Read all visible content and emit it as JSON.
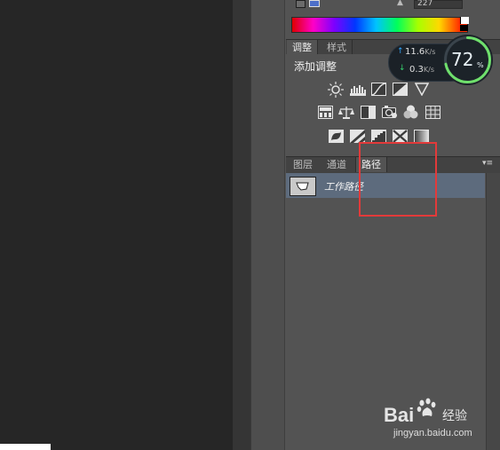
{
  "color_panel": {
    "value": "227",
    "colors": {
      "swatch": "#4d6fc9"
    }
  },
  "adjustments_panel": {
    "tabs": [
      "调整",
      "样式"
    ],
    "title": "添加调整",
    "row1": [
      "brightness-contrast-icon",
      "levels-icon",
      "curves-icon",
      "exposure-icon",
      "vibrance-icon"
    ],
    "row2": [
      "hue-saturation-icon",
      "color-balance-icon",
      "black-white-icon",
      "photo-filter-icon",
      "channel-mixer-icon",
      "color-lookup-icon"
    ],
    "row3": [
      "invert-icon",
      "posterize-icon",
      "threshold-icon",
      "selective-color-icon",
      "gradient-map-icon"
    ]
  },
  "network_widget": {
    "upload": "11.6",
    "upload_unit": "K/s",
    "download": "0.3",
    "download_unit": "K/s",
    "usage": "72",
    "usage_unit": "%"
  },
  "paths_panel": {
    "tabs": [
      "图层",
      "通道",
      "路径"
    ],
    "active_tab": "路径",
    "items": [
      {
        "name": "工作路径"
      }
    ]
  },
  "watermark": {
    "brand": "Bai",
    "brand_suffix": "经验",
    "url": "jingyan.baidu.com"
  }
}
